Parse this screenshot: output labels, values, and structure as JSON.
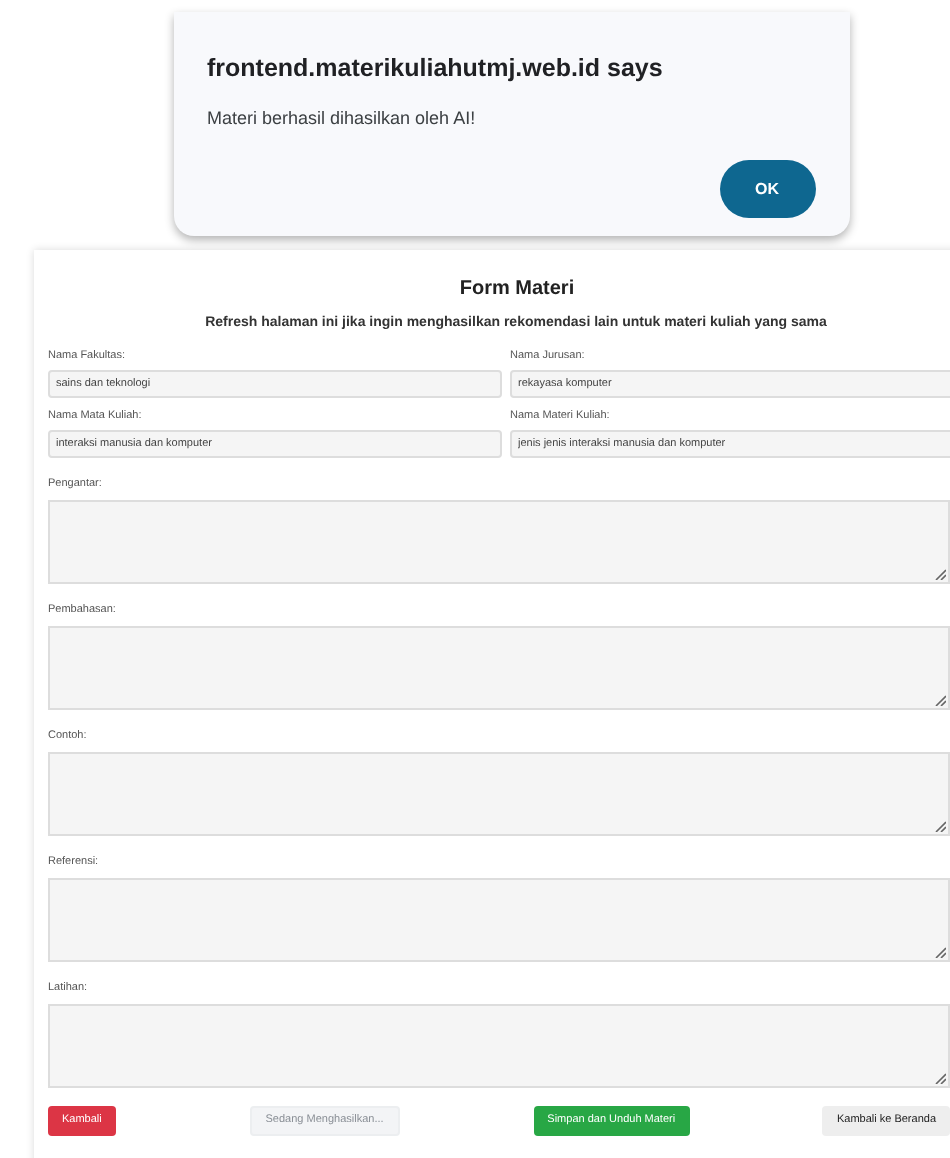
{
  "dialog": {
    "title": "frontend.materikuliahutmj.web.id says",
    "message": "Materi berhasil dihasilkan oleh AI!",
    "button": "OK"
  },
  "form": {
    "title": "Form Materi",
    "subtitle": "Refresh halaman ini jika ingin menghasilkan rekomendasi lain untuk materi kuliah yang sama",
    "fields": [
      {
        "label": "Nama Fakultas:",
        "value": "sains dan teknologi"
      },
      {
        "label": "Nama Jurusan:",
        "value": "rekayasa komputer"
      },
      {
        "label": "Nama Mata Kuliah:",
        "value": "interaksi manusia dan komputer"
      },
      {
        "label": "Nama Materi Kuliah:",
        "value": "jenis jenis interaksi manusia dan komputer"
      }
    ],
    "sections": [
      {
        "label": "Pengantar:"
      },
      {
        "label": "Pembahasan:"
      },
      {
        "label": "Contoh:"
      },
      {
        "label": "Referensi:"
      },
      {
        "label": "Latihan:"
      }
    ],
    "buttons": [
      {
        "label": "Kambali",
        "kind": "danger",
        "disabled": false
      },
      {
        "label": "Sedang Menghasilkan...",
        "kind": "primary",
        "disabled": true
      },
      {
        "label": "Simpan dan Unduh Materi",
        "kind": "success",
        "disabled": false
      },
      {
        "label": "Kambali ke Beranda",
        "kind": "secondary",
        "disabled": false
      }
    ]
  }
}
